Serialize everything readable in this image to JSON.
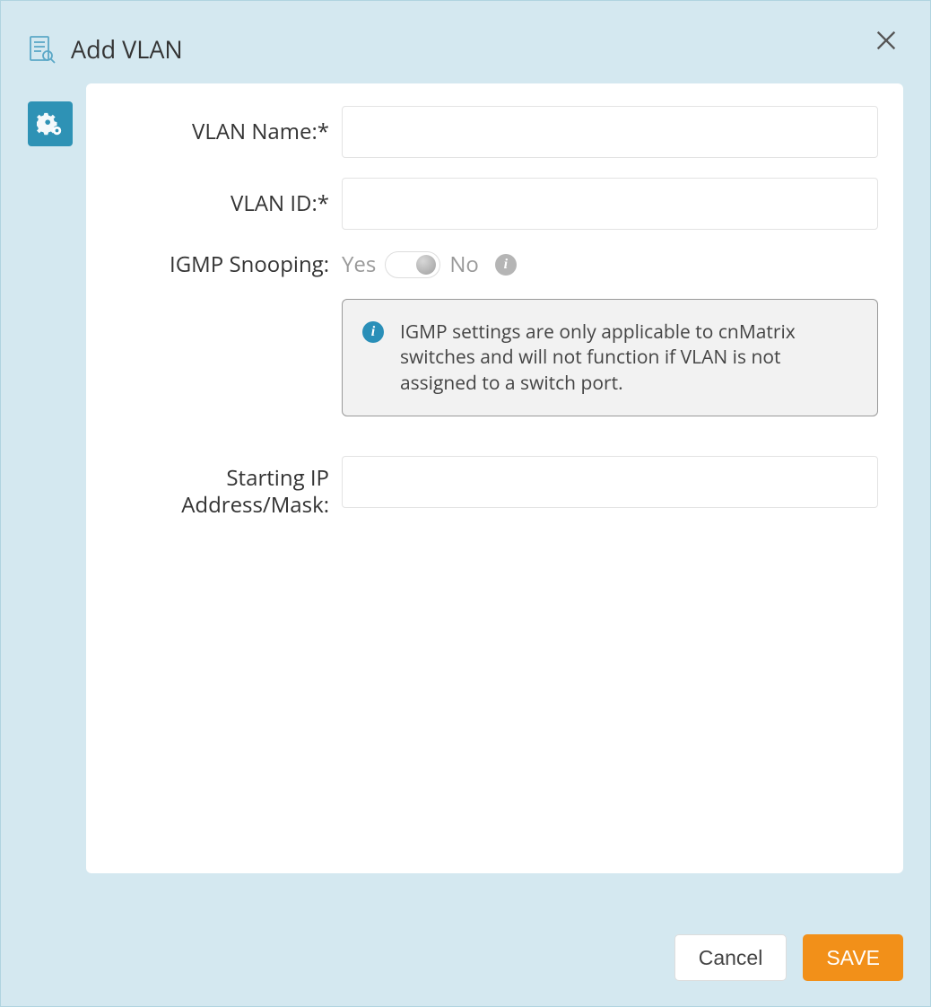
{
  "header": {
    "title": "Add VLAN"
  },
  "form": {
    "vlan_name": {
      "label": "VLAN Name:*",
      "value": ""
    },
    "vlan_id": {
      "label": "VLAN ID:*",
      "value": ""
    },
    "igmp": {
      "label": "IGMP Snooping:",
      "yes": "Yes",
      "no": "No",
      "state": "no"
    },
    "info_text": "IGMP settings are only applicable to cnMatrix switches and will not function if VLAN is not assigned to a switch port.",
    "starting_ip": {
      "label": "Starting IP Address/Mask:",
      "value": ""
    }
  },
  "footer": {
    "cancel": "Cancel",
    "save": "SAVE"
  }
}
